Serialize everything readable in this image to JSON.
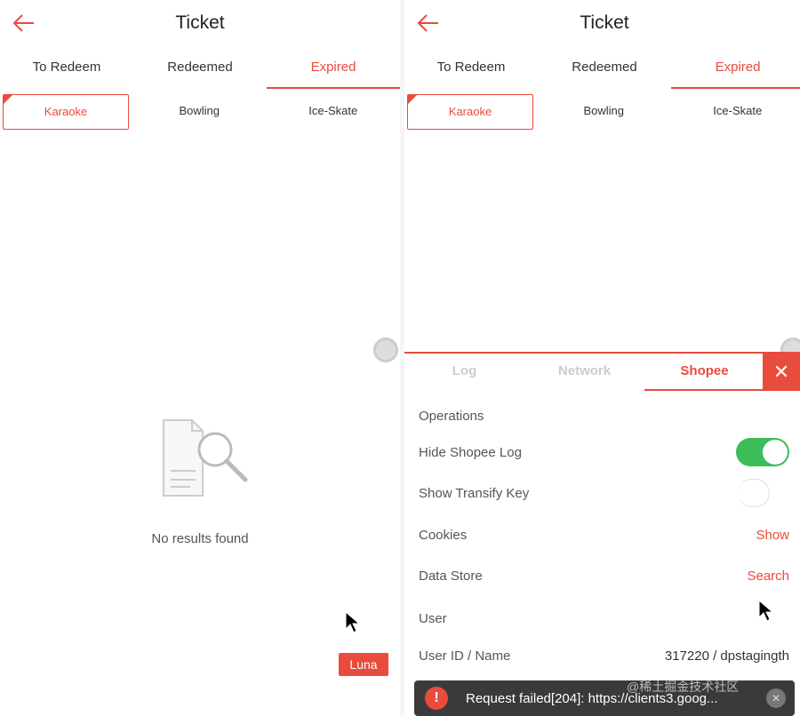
{
  "left": {
    "title": "Ticket",
    "tabs": [
      "To Redeem",
      "Redeemed",
      "Expired"
    ],
    "chips": [
      "Karaoke",
      "Bowling",
      "Ice-Skate"
    ],
    "empty_text": "No results found",
    "luna_label": "Luna"
  },
  "right": {
    "title": "Ticket",
    "tabs": [
      "To Redeem",
      "Redeemed",
      "Expired"
    ],
    "chips": [
      "Karaoke",
      "Bowling",
      "Ice-Skate"
    ],
    "debug": {
      "tabs": [
        "Log",
        "Network",
        "Shopee"
      ],
      "close": "✕",
      "operations": "Operations",
      "hide_log": "Hide Shopee Log",
      "show_transify": "Show Transify Key",
      "cookies": "Cookies",
      "cookies_action": "Show",
      "data_store": "Data Store",
      "data_store_action": "Search",
      "user": "User",
      "user_id_label": "User ID / Name",
      "user_id_value": "317220 / dpstagingth"
    },
    "toast": {
      "text": "Request failed[204]: https://clients3.goog...",
      "icon": "!"
    }
  },
  "watermark": "@稀土掘金技术社区",
  "colors": {
    "accent": "#e94b3c",
    "toggle_on": "#3dbd5a"
  }
}
